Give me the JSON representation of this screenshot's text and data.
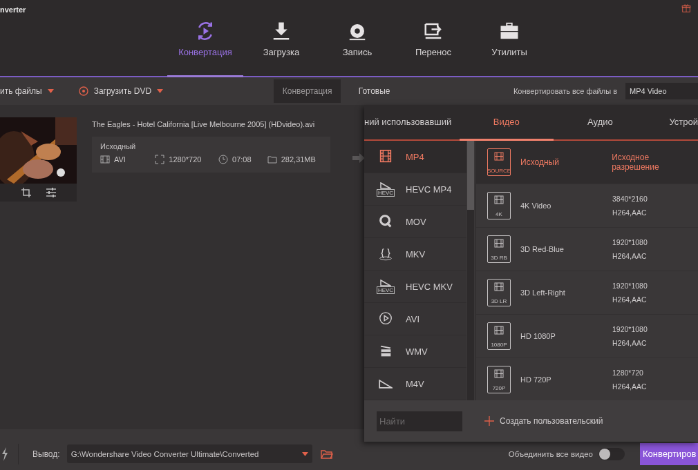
{
  "app_title": "nverter",
  "nav": [
    {
      "label": "Конвертация",
      "kind": "convert",
      "selected": true
    },
    {
      "label": "Загрузка",
      "kind": "download",
      "selected": false
    },
    {
      "label": "Запись",
      "kind": "record",
      "selected": false
    },
    {
      "label": "Перенос",
      "kind": "transfer",
      "selected": false
    },
    {
      "label": "Утилиты",
      "kind": "tools",
      "selected": false
    }
  ],
  "toolbar": {
    "add_files": "ить файлы",
    "load_dvd": "Загрузить DVD",
    "subtabs": [
      {
        "label": "Конвертация",
        "selected": true
      },
      {
        "label": "Готовые",
        "selected": false
      }
    ],
    "convert_all_label": "Конвертировать все файлы в",
    "convert_all_value": "MP4 Video"
  },
  "file": {
    "name": "The Eagles - Hotel California [Live Melbourne 2005] (HDvideo).avi",
    "profile": "Исходный",
    "format": "AVI",
    "resolution": "1280*720",
    "duration": "07:08",
    "size": "282,31MB"
  },
  "format_popup": {
    "tabs": [
      {
        "label": "ний использовавший",
        "selected": false
      },
      {
        "label": "Видео",
        "selected": true
      },
      {
        "label": "Аудио",
        "selected": false
      },
      {
        "label": "Устрой",
        "selected": false
      }
    ],
    "formats": [
      {
        "label": "MP4",
        "kind": "film",
        "selected": true
      },
      {
        "label": "HEVC MP4",
        "kind": "hevc",
        "badge": "HEVC",
        "selected": false
      },
      {
        "label": "MOV",
        "kind": "q",
        "selected": false
      },
      {
        "label": "MKV",
        "kind": "braces",
        "selected": false
      },
      {
        "label": "HEVC MKV",
        "kind": "hevc",
        "badge": "HEVC",
        "selected": false
      },
      {
        "label": "AVI",
        "kind": "play",
        "selected": false
      },
      {
        "label": "WMV",
        "kind": "clapper",
        "selected": false
      },
      {
        "label": "M4V",
        "kind": "triangle",
        "selected": false
      }
    ],
    "presets": [
      {
        "name": "Исходный",
        "badge": "SOURCE",
        "resolution": "Исходное разрешение",
        "selected": true
      },
      {
        "name": "4K Video",
        "badge": "4K",
        "resolution": "3840*2160",
        "codec": "H264,AAC",
        "selected": false
      },
      {
        "name": "3D Red-Blue",
        "badge": "3D RB",
        "resolution": "1920*1080",
        "codec": "H264,AAC",
        "selected": false
      },
      {
        "name": "3D Left-Right",
        "badge": "3D LR",
        "resolution": "1920*1080",
        "codec": "H264,AAC",
        "selected": false
      },
      {
        "name": "HD 1080P",
        "badge": "1080P",
        "resolution": "1920*1080",
        "codec": "H264,AAC",
        "selected": false
      },
      {
        "name": "HD 720P",
        "badge": "720P",
        "resolution": "1280*720",
        "codec": "H264,AAC",
        "selected": false
      }
    ],
    "search": {
      "placeholder": "Найти"
    },
    "create_custom": "Создать пользовательский"
  },
  "bottom": {
    "output_label": "Вывод:",
    "output_path": "G:\\Wondershare Video Converter Ultimate\\Converted",
    "merge_label": "Объединить все видео",
    "merge_on": false,
    "convert_button": "Конвертиров"
  }
}
